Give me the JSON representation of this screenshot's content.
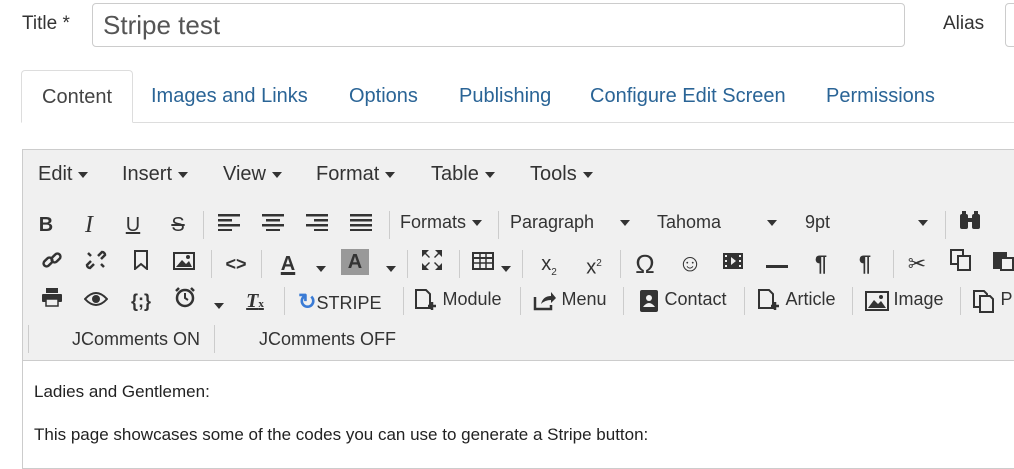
{
  "title_row": {
    "title_label": "Title *",
    "title_value": "Stripe test",
    "alias_label": "Alias"
  },
  "tabs": [
    {
      "label": "Content"
    },
    {
      "label": "Images and Links"
    },
    {
      "label": "Options"
    },
    {
      "label": "Publishing"
    },
    {
      "label": "Configure Edit Screen"
    },
    {
      "label": "Permissions"
    }
  ],
  "menubar": {
    "edit": "Edit",
    "insert": "Insert",
    "view": "View",
    "format": "Format",
    "table": "Table",
    "tools": "Tools"
  },
  "toolbar1": {
    "formats": "Formats",
    "paragraph": "Paragraph",
    "font": "Tahoma",
    "size": "9pt"
  },
  "toolbar3": {
    "stripe": "STRIPE",
    "module": "Module",
    "menu": "Menu",
    "contact": "Contact",
    "article": "Article",
    "image": "Image",
    "page_break": "P"
  },
  "toolbar4": {
    "jcomments_on": "JComments ON",
    "jcomments_off": "JComments OFF"
  },
  "content": {
    "line1": "Ladies and Gentlemen:",
    "line2": "This page showcases some of the codes you can use to generate a Stripe button:"
  },
  "colors": {
    "link": "#2a6496",
    "toolbar_bg": "#f0f0f0",
    "stripe_icon": "#3a7bd5"
  }
}
